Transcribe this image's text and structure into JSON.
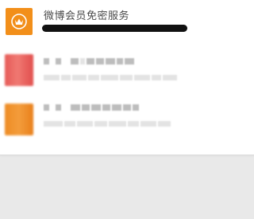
{
  "service": {
    "title": "微博会员免密服务",
    "icon": "crown-icon",
    "icon_color": "#f28f1a"
  },
  "list_items": [
    {
      "icon": "app-thumbnail-red",
      "color": "#e65b57"
    },
    {
      "icon": "app-thumbnail-orange",
      "color": "#ee8c24"
    }
  ]
}
